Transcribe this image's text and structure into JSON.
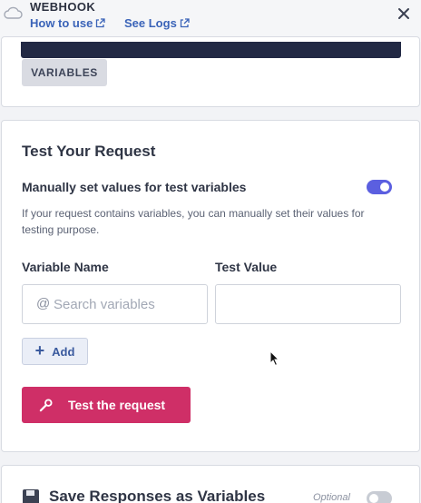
{
  "header": {
    "title": "WEBHOOK",
    "how_to_use": "How to use",
    "see_logs": "See Logs",
    "icons": {
      "logo": "cloud-icon",
      "external": "external-link-icon",
      "close": "close-icon"
    }
  },
  "variables_section": {
    "button_label": "VARIABLES"
  },
  "test_section": {
    "title": "Test Your Request",
    "toggle_label": "Manually set values for test variables",
    "toggle_on": true,
    "help_text": "If your request contains variables, you can manually set their values for testing purpose.",
    "variable_name_label": "Variable Name",
    "test_value_label": "Test Value",
    "search_prefix": "@",
    "search_placeholder": "Search variables",
    "test_value": "",
    "add_label": "Add",
    "test_button_label": "Test the request",
    "accent_color": "#cf2f67",
    "toggle_color": "#5b5fe0"
  },
  "save_section": {
    "title": "Save Responses as Variables",
    "optional_label": "Optional",
    "toggle_on": false
  }
}
